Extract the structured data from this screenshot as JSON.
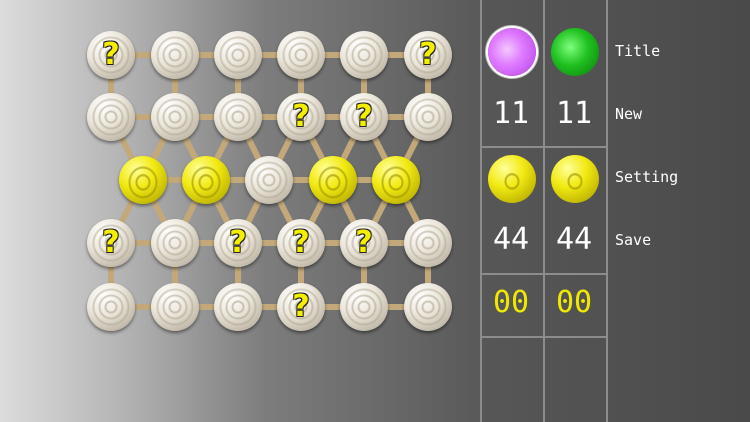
{
  "board": {
    "rows": [
      [
        "white-q",
        "white",
        "white",
        "white",
        "white",
        "white-q"
      ],
      [
        "white",
        "white",
        "white",
        "white-q",
        "white-q",
        "white"
      ],
      [
        "yellow",
        "yellow",
        "white",
        "yellow",
        "yellow"
      ],
      [
        "white-q",
        "white",
        "white-q",
        "white-q",
        "white-q",
        "white"
      ],
      [
        "white",
        "white",
        "white",
        "white-q",
        "white",
        "white"
      ]
    ],
    "question_mark": "?",
    "colors": {
      "link": "#c2a87a",
      "yellow": "#f2ea12",
      "white": "#ece7dc",
      "q_text": "#f4ee00"
    }
  },
  "scores": {
    "player1": {
      "ball_color": "purple",
      "value1": "11",
      "value2": "44",
      "value3": "00"
    },
    "player2": {
      "ball_color": "green",
      "value1": "11",
      "value2": "44",
      "value3": "00"
    }
  },
  "menu": {
    "title": "Title",
    "new": "New",
    "setting": "Setting",
    "save": "Save"
  }
}
